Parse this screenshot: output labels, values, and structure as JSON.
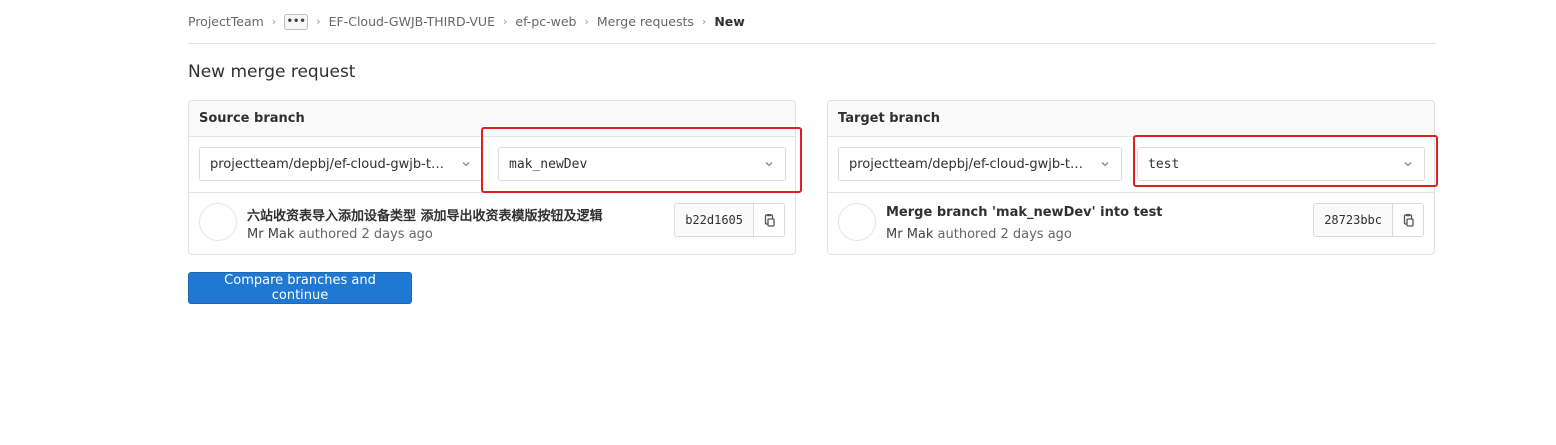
{
  "breadcrumb": {
    "items": [
      "ProjectTeam",
      "EF-Cloud-GWJB-THIRD-VUE",
      "ef-pc-web",
      "Merge requests"
    ],
    "current": "New",
    "more_label": "•••"
  },
  "page": {
    "title": "New merge request"
  },
  "source": {
    "heading": "Source branch",
    "project": "projectteam/depbj/ef-cloud-gwjb-third-vue",
    "branch": "mak_newDev",
    "commit": {
      "title": "六站收资表导入添加设备类型 添加导出收资表模版按钮及逻辑",
      "author": "Mr Mak",
      "meta": "authored 2 days ago",
      "sha": "b22d1605"
    }
  },
  "target": {
    "heading": "Target branch",
    "project": "projectteam/depbj/ef-cloud-gwjb-third-vue",
    "branch": "test",
    "commit": {
      "title": "Merge branch 'mak_newDev' into test",
      "author": "Mr Mak",
      "meta": "authored 2 days ago",
      "sha": "28723bbc"
    }
  },
  "actions": {
    "compare_label": "Compare branches and continue"
  },
  "icons": {
    "chevron": "chevron-down-icon",
    "copy": "copy-icon",
    "breadcrumb_separator": "chevron-right-icon"
  },
  "colors": {
    "primary_button": "#1f78d1",
    "highlight": "#e02020"
  }
}
